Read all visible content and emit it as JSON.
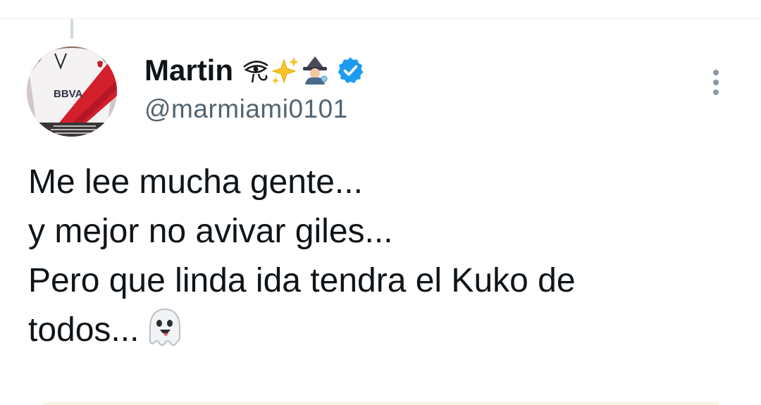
{
  "tweet": {
    "author": {
      "display_name": "Martin",
      "name_emojis": [
        "eye-of-horus-icon",
        "sparkles-icon",
        "mage-icon"
      ],
      "handle": "@marmiami0101",
      "verified": true,
      "avatar_icon": "river-plate-jersey-avatar",
      "avatar_jersey_text": "BBVA"
    },
    "text_lines": [
      "Me lee mucha gente...",
      "y mejor no avivar giles...",
      "Pero que linda ida tendra el Kuko de",
      "todos..."
    ],
    "trailing_emoji": "ghost-icon",
    "menu_icon": "more-vertical-icon"
  },
  "colors": {
    "text_primary": "#0f1419",
    "text_secondary": "#536471",
    "verified_blue": "#1d9bf0",
    "divider": "#e8eaed",
    "thread_line": "#cfd9de",
    "icon_gray": "#8b98a5"
  }
}
